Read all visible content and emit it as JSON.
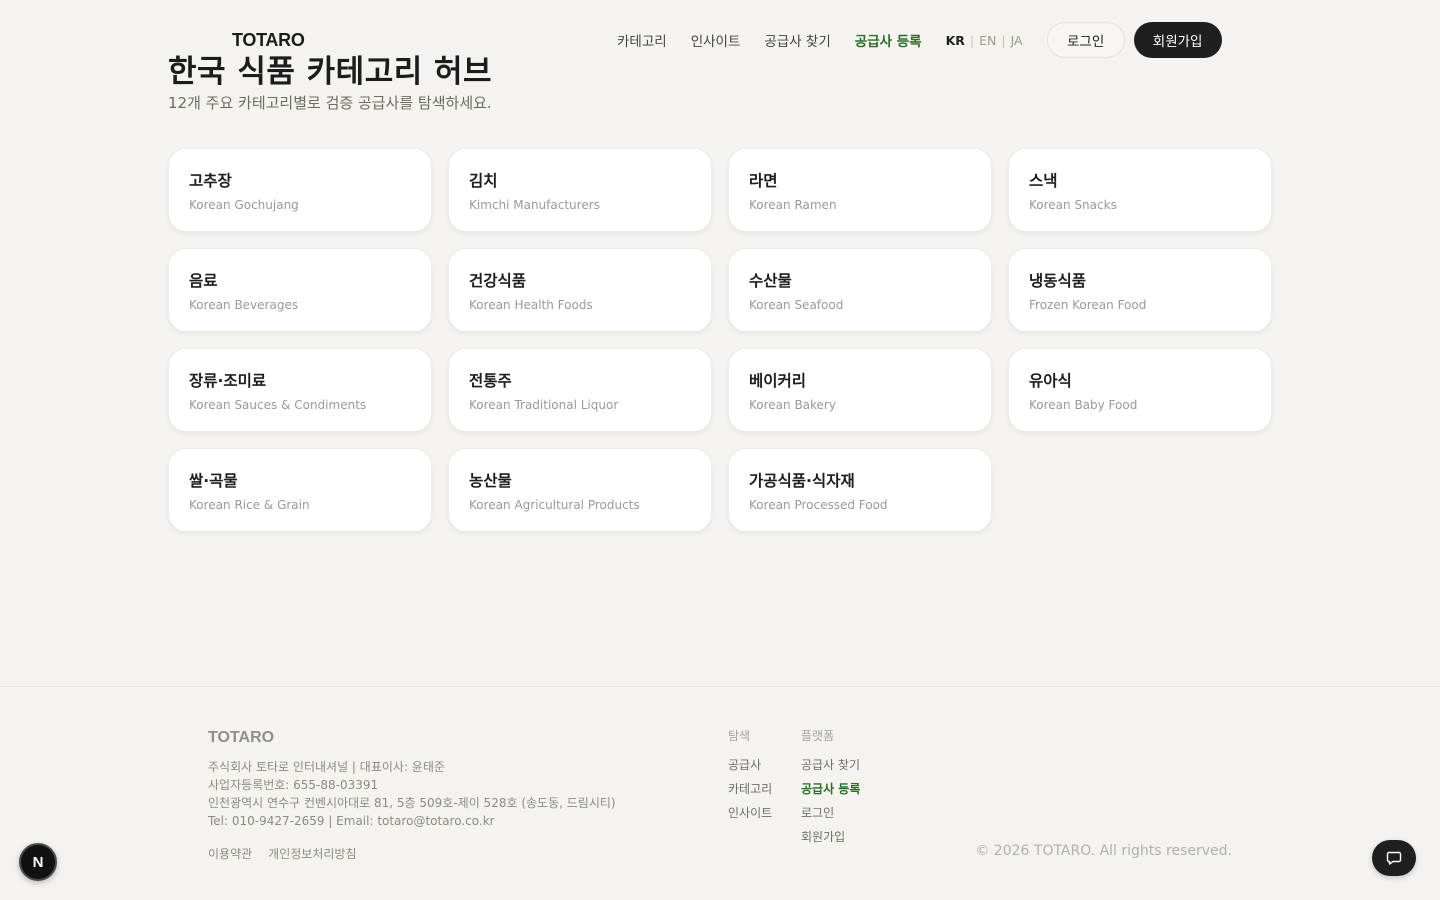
{
  "header": {
    "brand": "TOTARO",
    "nav": [
      {
        "label": "카테고리",
        "active": false
      },
      {
        "label": "인사이트",
        "active": false
      },
      {
        "label": "공급사 찾기",
        "active": false
      },
      {
        "label": "공급사 등록",
        "active": true
      }
    ],
    "languages": [
      "KR",
      "EN",
      "JA"
    ],
    "active_language": "KR",
    "login_label": "로그인",
    "signup_label": "회원가입"
  },
  "main": {
    "title": "한국 식품 카테고리 허브",
    "subtitle": "12개 주요 카테고리별로 검증 공급사를 탐색하세요.",
    "categories": [
      {
        "ko": "고추장",
        "en": "Korean Gochujang"
      },
      {
        "ko": "김치",
        "en": "Kimchi Manufacturers"
      },
      {
        "ko": "라면",
        "en": "Korean Ramen"
      },
      {
        "ko": "스낵",
        "en": "Korean Snacks"
      },
      {
        "ko": "음료",
        "en": "Korean Beverages"
      },
      {
        "ko": "건강식품",
        "en": "Korean Health Foods"
      },
      {
        "ko": "수산물",
        "en": "Korean Seafood"
      },
      {
        "ko": "냉동식품",
        "en": "Frozen Korean Food"
      },
      {
        "ko": "장류·조미료",
        "en": "Korean Sauces & Condiments"
      },
      {
        "ko": "전통주",
        "en": "Korean Traditional Liquor"
      },
      {
        "ko": "베이커리",
        "en": "Korean Bakery"
      },
      {
        "ko": "유아식",
        "en": "Korean Baby Food"
      },
      {
        "ko": "쌀·곡물",
        "en": "Korean Rice & Grain"
      },
      {
        "ko": "농산물",
        "en": "Korean Agricultural Products"
      },
      {
        "ko": "가공식품·식자재",
        "en": "Korean Processed Food"
      }
    ]
  },
  "footer": {
    "brand": "TOTARO",
    "company_line": "주식회사 토타로 인터내셔널 | 대표이사: 윤태준",
    "biz_number": "사업자등록번호: 655-88-03391",
    "address": "인천광역시 연수구 컨벤시아대로 81, 5층 509호-제이 528호 (송도동, 드림시티)",
    "contact": "Tel: 010-9427-2659 | Email: totaro@totaro.co.kr",
    "legal": [
      "이용약관",
      "개인정보처리방침"
    ],
    "explore": {
      "heading": "탐색",
      "links": [
        {
          "label": "공급사",
          "active": false
        },
        {
          "label": "카테고리",
          "active": false
        },
        {
          "label": "인사이트",
          "active": false
        }
      ]
    },
    "platform": {
      "heading": "플랫폼",
      "links": [
        {
          "label": "공급사 찾기",
          "active": false
        },
        {
          "label": "공급사 등록",
          "active": true
        },
        {
          "label": "로그인",
          "active": false
        },
        {
          "label": "회원가입",
          "active": false
        }
      ]
    },
    "copyright": "© 2026 TOTARO. All rights reserved."
  },
  "overlay": {
    "badge_letter": "N",
    "chat_icon": "chat-bubble-icon"
  },
  "colors": {
    "background": "#f4f3ef",
    "accent_green": "#2f6b2a",
    "dark": "#1f1f1f"
  }
}
